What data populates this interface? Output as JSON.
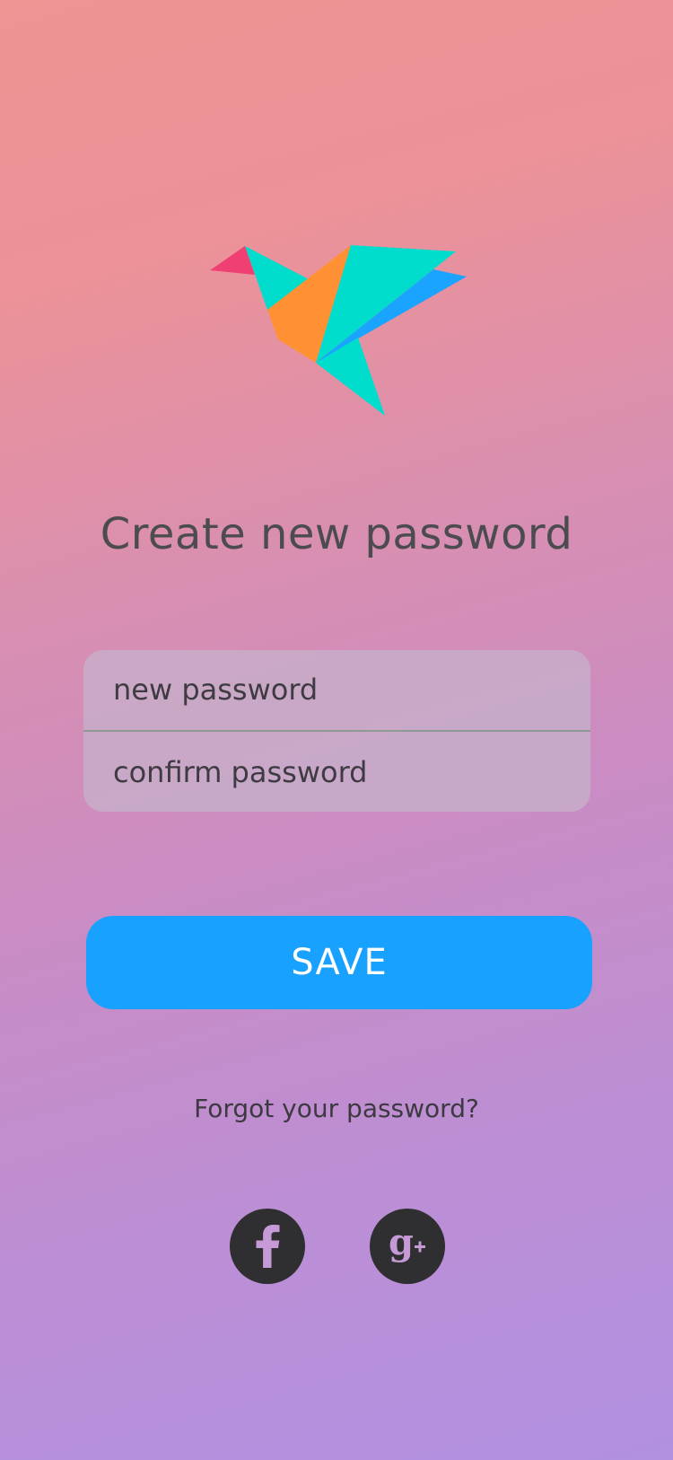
{
  "brand": {
    "logo_name": "origami-bird-logo",
    "colors": {
      "pink": "#ef3f73",
      "teal": "#00ddcc",
      "orange": "#ff9033",
      "blue": "#1aa3ff"
    }
  },
  "screen": {
    "title": "Create new password"
  },
  "form": {
    "new_password_placeholder": "new password",
    "confirm_password_placeholder": "confirm password"
  },
  "actions": {
    "save_label": "SAVE",
    "forgot_label": "Forgot your password?"
  },
  "social": {
    "facebook_icon": "facebook-icon",
    "google_plus_icon": "google-plus-icon",
    "icon_color": "#c69ad7"
  }
}
